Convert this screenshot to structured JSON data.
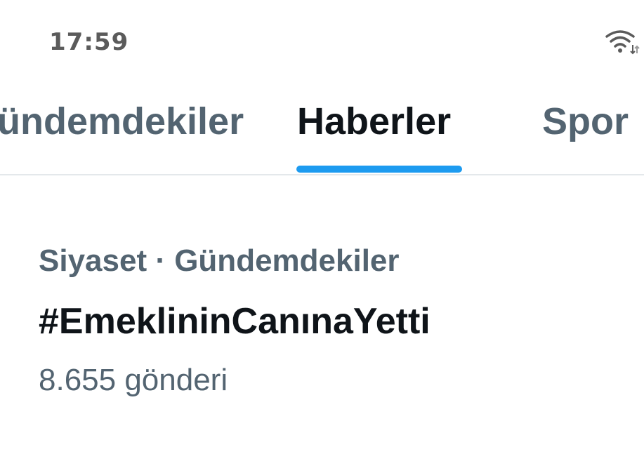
{
  "status_bar": {
    "time": "17:59",
    "icon": "wifi-icon"
  },
  "tabs": [
    {
      "label": "Gündemdekiler",
      "visible_label": "ündemdekiler",
      "selected": false
    },
    {
      "label": "Haberler",
      "selected": true
    },
    {
      "label": "Spor",
      "selected": false
    }
  ],
  "colors": {
    "accent": "#1d9bf0",
    "text_primary": "#0f1419",
    "text_secondary": "#536471",
    "divider": "#e4e8eb"
  },
  "trend": {
    "category": "Siyaset",
    "separator": "·",
    "context": "Gündemdekiler",
    "meta": "Siyaset · Gündemdekiler",
    "title": "#EmeklininCanınaYetti",
    "count": "8.655 gönderi"
  }
}
